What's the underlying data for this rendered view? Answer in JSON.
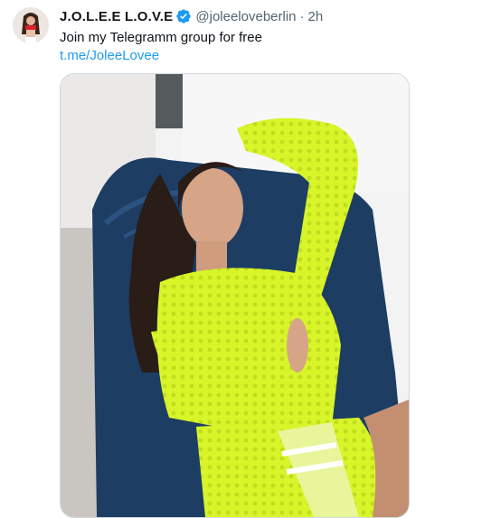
{
  "tweet": {
    "display_name": "J.O.L.E.E L.O.V.E",
    "handle": "@joleeloveberlin",
    "separator": "·",
    "time": "2h",
    "text": "Join my Telegramm group for free",
    "link": "t.me/JoleeLovee"
  },
  "colors": {
    "link": "#1d9bf0",
    "verified": "#1d9bf0",
    "secondary_text": "#536471"
  }
}
